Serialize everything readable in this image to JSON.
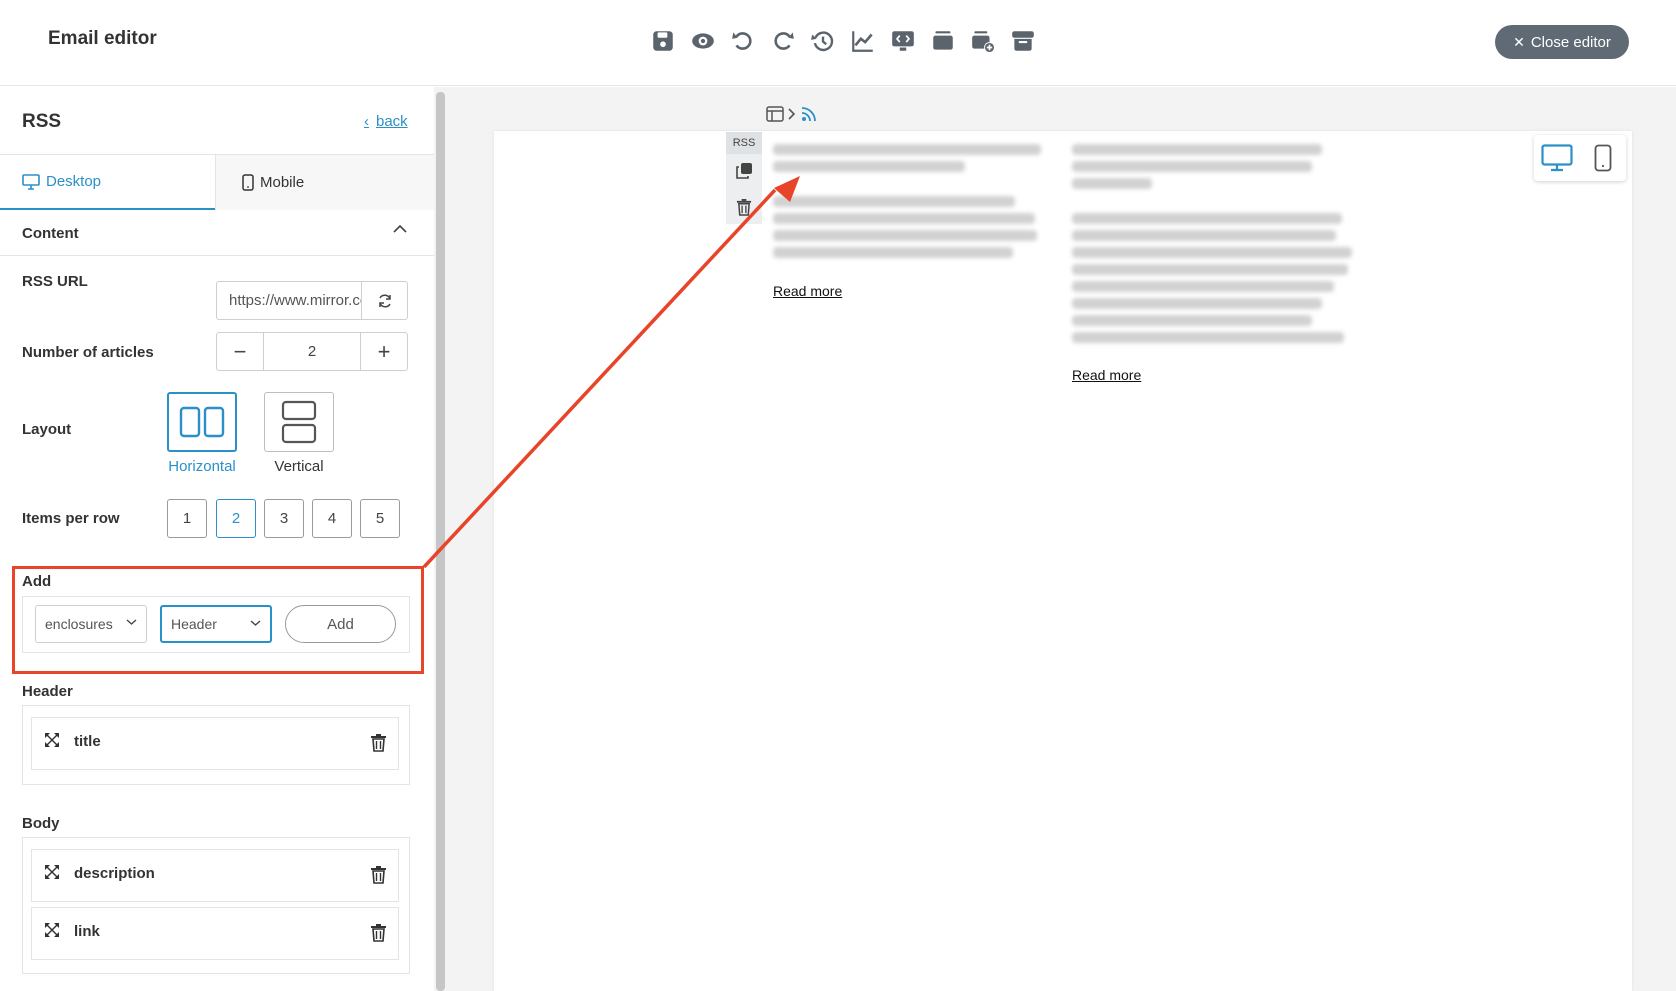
{
  "header": {
    "title": "Email editor",
    "close_label": "Close editor",
    "toolbar_icons": [
      "save-icon",
      "preview-icon",
      "undo-icon",
      "redo-icon",
      "history-icon",
      "analytics-icon",
      "screen-code-icon",
      "block-stack-icon",
      "add-block-icon",
      "archive-icon"
    ]
  },
  "sidebar": {
    "title": "RSS",
    "back_label": "back",
    "tabs": [
      {
        "label": "Desktop",
        "active": true
      },
      {
        "label": "Mobile",
        "active": false
      }
    ],
    "section_label": "Content",
    "rss_url": {
      "label": "RSS URL",
      "value": "https://www.mirror.co.uk/news/?service=rss"
    },
    "articles": {
      "label": "Number of articles",
      "value": "2",
      "minus": "−",
      "plus": "+"
    },
    "layout": {
      "label": "Layout",
      "options": [
        {
          "label": "Horizontal",
          "selected": true
        },
        {
          "label": "Vertical",
          "selected": false
        }
      ]
    },
    "items_per_row": {
      "label": "Items per row",
      "options": [
        "1",
        "2",
        "3",
        "4",
        "5"
      ],
      "selected": "2"
    },
    "add": {
      "label": "Add",
      "field_value": "enclosures",
      "section_value": "Header",
      "button_label": "Add"
    },
    "header_group": {
      "label": "Header",
      "items": [
        "title"
      ]
    },
    "body_group": {
      "label": "Body",
      "items": [
        "description",
        "link"
      ]
    }
  },
  "canvas": {
    "block_tag": "RSS",
    "read_more_labels": [
      "Read more",
      "Read more"
    ],
    "accent": "#2b90c8",
    "highlight": "#e8442a"
  }
}
